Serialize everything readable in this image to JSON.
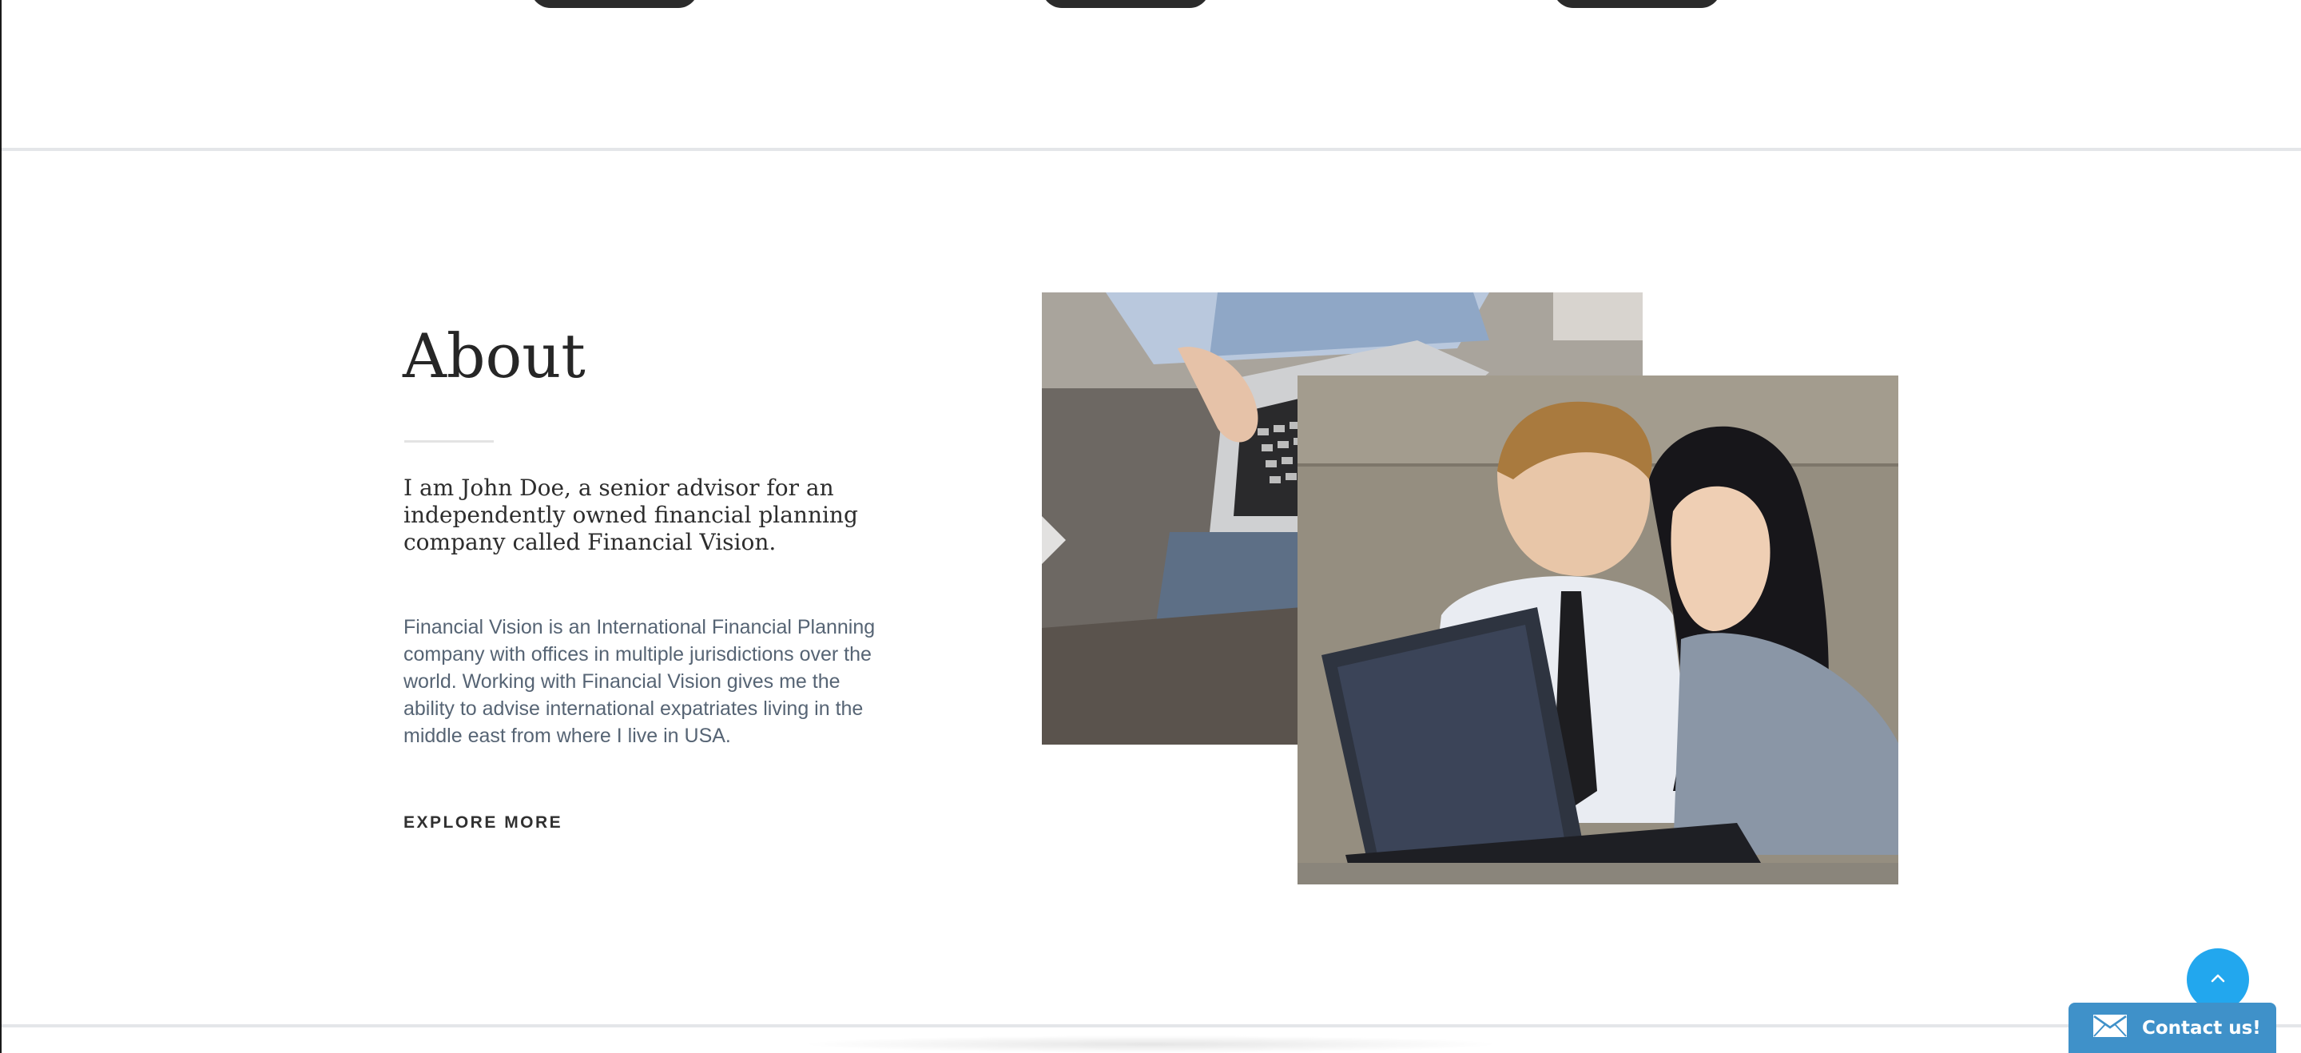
{
  "about": {
    "title": "About",
    "lead": "I am John Doe, a senior advisor for an independently owned financial planning company called Financial Vision.",
    "body": "Financial Vision is an International Financial Planning company with offices in multiple jurisdictions over the world. Working with Financial Vision gives me the ability to advise international expatriates living in the middle east from where I live in USA.",
    "cta": "EXPLORE MORE"
  },
  "images": {
    "back": {
      "icon": "laptop-hands-photo"
    },
    "front": {
      "icon": "business-people-laptop-photo"
    }
  },
  "widgets": {
    "scroll_top_icon": "chevron-up-icon",
    "contact": {
      "label": "Contact us!",
      "icon": "envelope-icon"
    }
  },
  "colors": {
    "accent_blue": "#22a7ee",
    "contact_blue": "#3f91c9",
    "body_text": "#566474",
    "heading": "#262626"
  }
}
